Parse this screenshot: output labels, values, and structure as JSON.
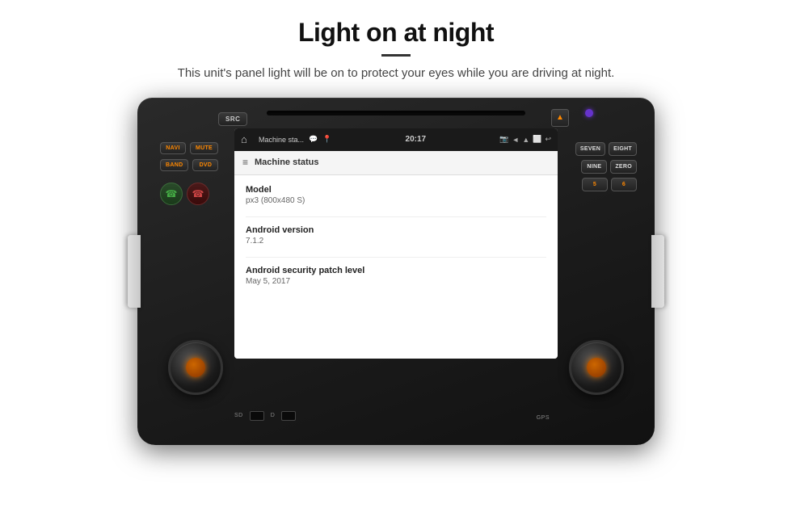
{
  "header": {
    "title": "Light on at night",
    "subtitle": "This unit's panel light will be on to protect your eyes while you are driving at night."
  },
  "device": {
    "buttons": {
      "src": "SRC",
      "navi": "NAVI",
      "mute": "MUTE",
      "band": "BAND",
      "dvd": "DVD",
      "seven": "SEVEN",
      "eight": "EIGHT",
      "nine": "NINE",
      "zero": "ZERO",
      "five": "5",
      "six": "6"
    },
    "sd_label": "SD",
    "d_label": "D",
    "gps_label": "GPS"
  },
  "screen": {
    "statusbar": {
      "app_name": "Machine sta...",
      "time": "20:17",
      "nav_icon": "▲",
      "icons": [
        "📷",
        "◄",
        "▲",
        "⬜",
        "↩"
      ]
    },
    "toolbar": {
      "menu_icon": "≡",
      "title": "Machine status"
    },
    "content": {
      "items": [
        {
          "label": "Model",
          "value": "px3 (800x480 S)"
        },
        {
          "label": "Android version",
          "value": "7.1.2"
        },
        {
          "label": "Android security patch level",
          "value": "May 5, 2017"
        }
      ]
    }
  }
}
